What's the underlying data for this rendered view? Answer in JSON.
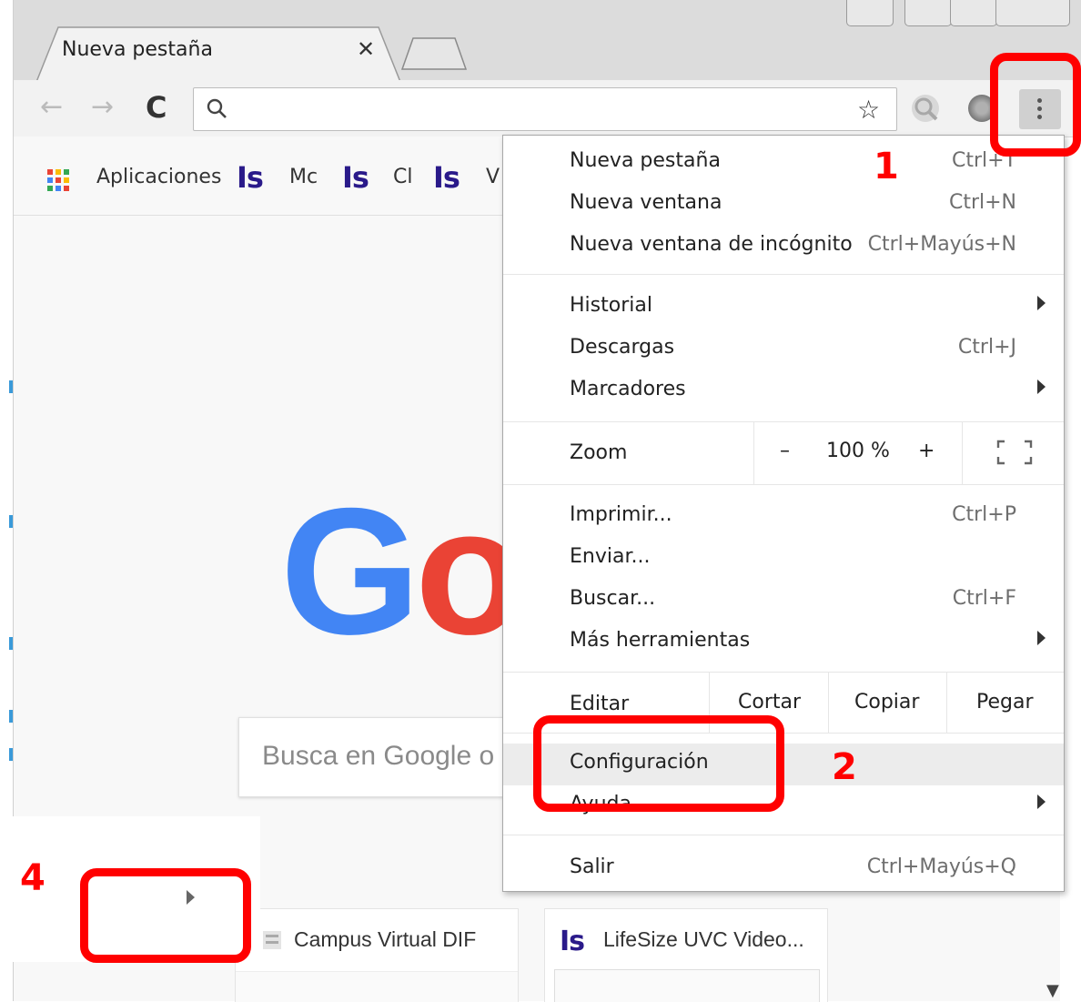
{
  "tab": {
    "title": "Nueva pestaña",
    "close_glyph": "✕"
  },
  "toolbar": {
    "back_glyph": "←",
    "forward_glyph": "→",
    "reload_glyph": "C",
    "search_glyph": "⚲",
    "address_value": "",
    "star_glyph": "☆"
  },
  "bookmarks": {
    "apps_label": "Aplicaciones",
    "items": [
      {
        "icon": "Is",
        "label": "Mc"
      },
      {
        "icon": "Is",
        "label": "Cl"
      },
      {
        "icon": "Is",
        "label": "V"
      }
    ]
  },
  "page": {
    "search_placeholder": "Busca en Google o",
    "tiles": [
      {
        "title": "Campus Virtual DIF"
      },
      {
        "icon": "Is",
        "title": "LifeSize UVC Video..."
      }
    ]
  },
  "menu": {
    "new_tab": {
      "label": "Nueva pestaña",
      "shortcut": "Ctrl+T"
    },
    "new_window": {
      "label": "Nueva ventana",
      "shortcut": "Ctrl+N"
    },
    "incognito": {
      "label": "Nueva ventana de incógnito",
      "shortcut": "Ctrl+Mayús+N"
    },
    "history": {
      "label": "Historial"
    },
    "downloads": {
      "label": "Descargas",
      "shortcut": "Ctrl+J"
    },
    "bookmarks": {
      "label": "Marcadores"
    },
    "zoom": {
      "label": "Zoom",
      "minus": "–",
      "value": "100 %",
      "plus": "+"
    },
    "print": {
      "label": "Imprimir...",
      "shortcut": "Ctrl+P"
    },
    "cast": {
      "label": "Enviar..."
    },
    "find": {
      "label": "Buscar...",
      "shortcut": "Ctrl+F"
    },
    "more_tools": {
      "label": "Más herramientas"
    },
    "edit": {
      "label": "Editar",
      "cut": "Cortar",
      "copy": "Copiar",
      "paste": "Pegar"
    },
    "settings": {
      "label": "Configuración"
    },
    "help": {
      "label": "Ayuda"
    },
    "exit": {
      "label": "Salir",
      "shortcut": "Ctrl+Mayús+Q"
    }
  },
  "annotations": {
    "step1": "1",
    "step2": "2",
    "step4": "4",
    "color": "#ff0000"
  },
  "colors": {
    "google_blue": "#4285f4",
    "google_red": "#ea4335",
    "bookmark_icon": "#2a1a8a"
  }
}
